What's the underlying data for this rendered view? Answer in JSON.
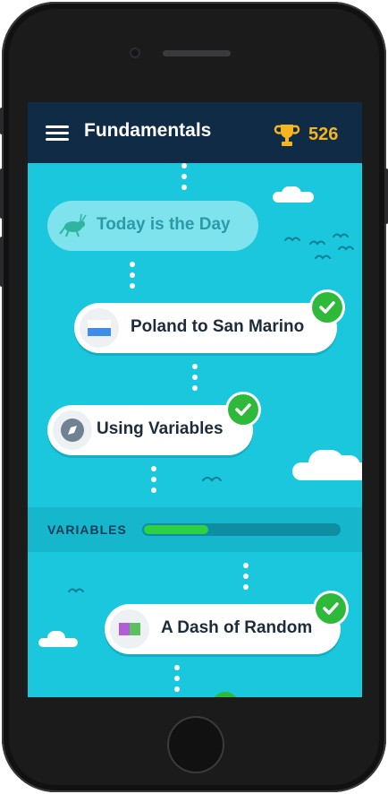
{
  "header": {
    "title": "Fundamentals",
    "score": "526"
  },
  "path": [
    {
      "label": "Today is the Day",
      "state": "current",
      "icon": "grasshopper-icon"
    },
    {
      "label": "Poland to San Marino",
      "state": "completed",
      "icon": "flag-icon"
    },
    {
      "label": "Using Variables",
      "state": "completed",
      "icon": "compass-icon"
    },
    {
      "label": "A Dash of Random",
      "state": "completed",
      "icon": "color-swatch-icon"
    }
  ],
  "section": {
    "label": "VARIABLES",
    "progress": 0.33
  },
  "colors": {
    "background": "#1ac7dd",
    "topbar": "#0f2b45",
    "accent_gold": "#f5b51f",
    "check_green": "#2fb93b",
    "progress_green": "#2fd043"
  }
}
